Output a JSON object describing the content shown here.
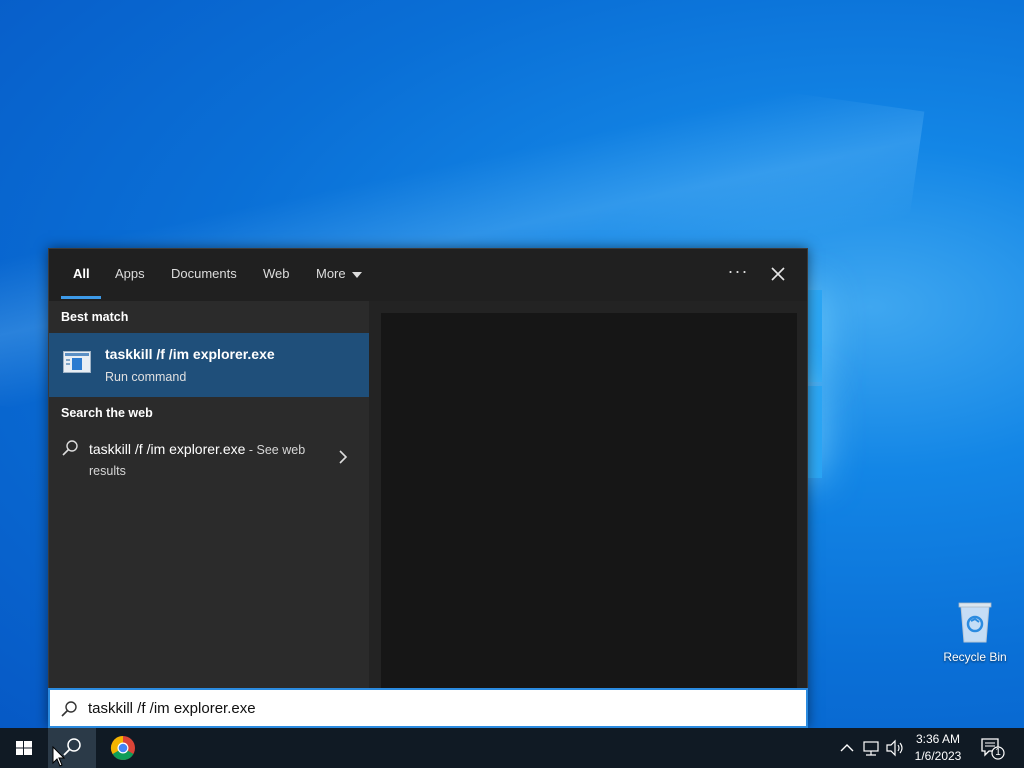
{
  "desktop": {
    "recycle_bin_label": "Recycle Bin"
  },
  "search_panel": {
    "tabs": [
      {
        "label": "All",
        "active": true
      },
      {
        "label": "Apps"
      },
      {
        "label": "Documents"
      },
      {
        "label": "Web"
      },
      {
        "label": "More"
      }
    ],
    "more_options_icon": "ellipsis-icon",
    "close_icon": "close-icon",
    "best_match": {
      "section_title": "Best match",
      "title": "taskkill /f /im explorer.exe",
      "subtitle": "Run command"
    },
    "web": {
      "section_title": "Search the web",
      "query": "taskkill /f /im explorer.exe",
      "suffix": " - See web results"
    },
    "search_input_value": "taskkill /f /im explorer.exe"
  },
  "taskbar": {
    "time": "3:36 AM",
    "date": "1/6/2023",
    "notification_count": "1"
  },
  "colors": {
    "accent": "#3d9ae8",
    "selected_item": "#1f4f7a",
    "panel_bg": "#2b2b2b",
    "taskbar_bg": "#101a24"
  }
}
